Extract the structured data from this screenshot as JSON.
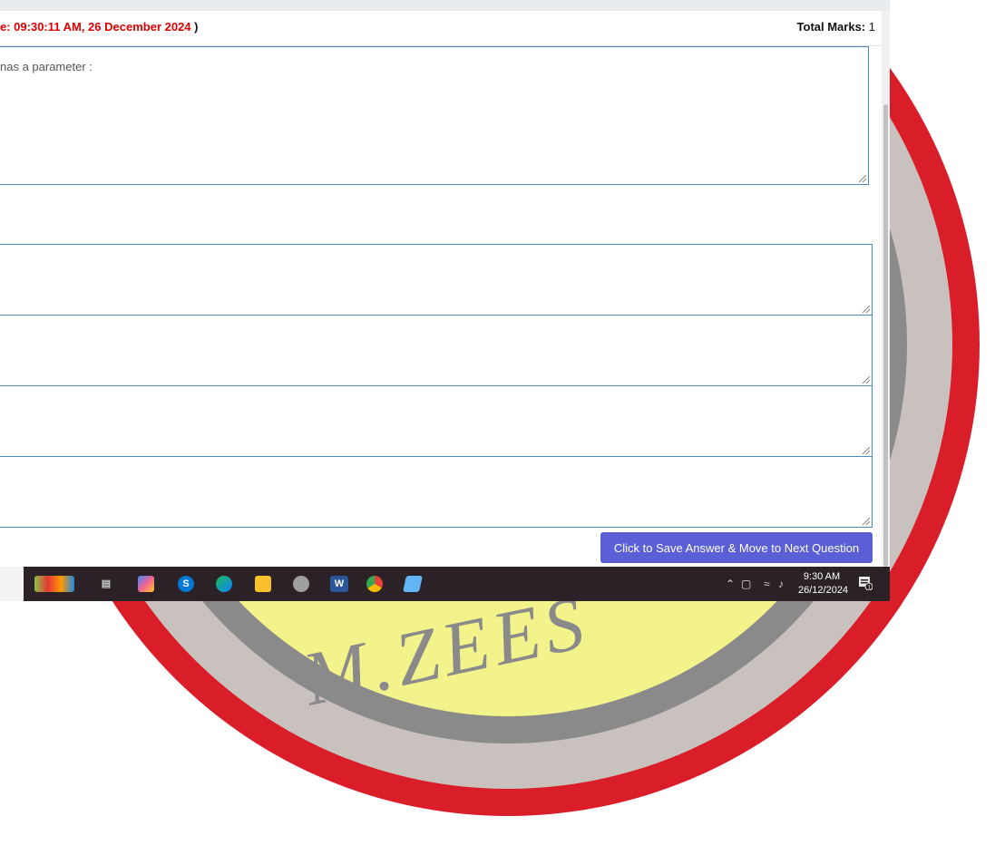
{
  "header": {
    "time_text": "e: 09:30:11 AM, 26 December 2024",
    "time_close": ")",
    "total_marks_label": "Total Marks:",
    "total_marks_value": "1"
  },
  "question": {
    "text": "nas a parameter :"
  },
  "answers": [
    "",
    "",
    "",
    ""
  ],
  "save_button": {
    "label": "Click to Save Answer & Move to Next Question"
  },
  "taskbar": {
    "time": "9:30 AM",
    "date": "26/12/2024",
    "notification_count": "1",
    "icons": [
      "gifts-icon",
      "task-view-icon",
      "copilot-icon",
      "skype-icon",
      "edge-icon",
      "file-explorer-icon",
      "snip-icon",
      "word-icon",
      "chrome-icon",
      "notepad-icon"
    ]
  },
  "watermark": {
    "text": "M.ZEES"
  },
  "colors": {
    "accent_button": "#5b5fd6",
    "time_red": "#e00000",
    "field_border": "#4a8bbf",
    "taskbar": "#2a2226"
  }
}
